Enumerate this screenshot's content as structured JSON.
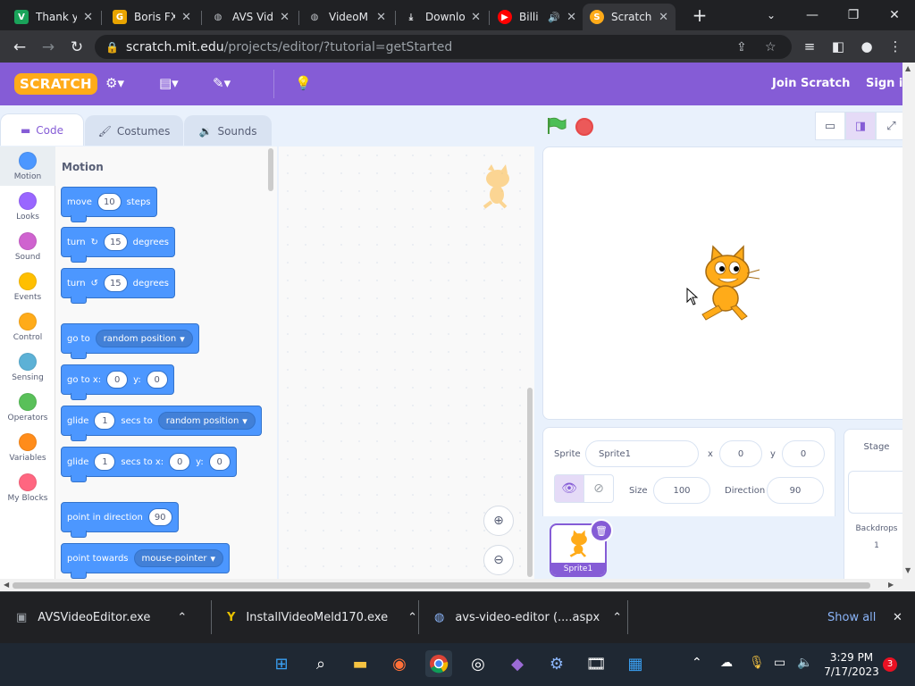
{
  "browser": {
    "tabs": [
      {
        "title": "Thank y",
        "icon": "vimeo-icon",
        "color": "#1aa35a"
      },
      {
        "title": "Boris FX",
        "icon": "g-icon",
        "color": "#e8a400"
      },
      {
        "title": "AVS Vid",
        "icon": "globe-icon",
        "color": "#5f6368"
      },
      {
        "title": "VideoM",
        "icon": "globe-icon",
        "color": "#5f6368"
      },
      {
        "title": "Downlo",
        "icon": "download-icon",
        "color": "#5f6368"
      },
      {
        "title": "Billi",
        "icon": "youtube-icon",
        "color": "#ff0000"
      },
      {
        "title": "Scratch",
        "icon": "scratch-icon",
        "color": "#ffab19"
      }
    ],
    "url_host": "scratch.mit.edu",
    "url_path": "/projects/editor/?tutorial=getStarted"
  },
  "scratch": {
    "menu": {
      "logo": "SCRATCH",
      "join": "Join Scratch",
      "signin": "Sign in"
    },
    "editor_tabs": {
      "code": "Code",
      "costumes": "Costumes",
      "sounds": "Sounds"
    },
    "categories": [
      {
        "label": "Motion",
        "color": "#4c97ff"
      },
      {
        "label": "Looks",
        "color": "#9966ff"
      },
      {
        "label": "Sound",
        "color": "#cf63cf"
      },
      {
        "label": "Events",
        "color": "#ffbf00"
      },
      {
        "label": "Control",
        "color": "#ffab19"
      },
      {
        "label": "Sensing",
        "color": "#5cb1d6"
      },
      {
        "label": "Operators",
        "color": "#59c059"
      },
      {
        "label": "Variables",
        "color": "#ff8c1a"
      },
      {
        "label": "My Blocks",
        "color": "#ff6680"
      }
    ],
    "palette": {
      "title": "Motion",
      "move": {
        "a": "move",
        "n": "10",
        "b": "steps"
      },
      "turn_cw": {
        "a": "turn",
        "n": "15",
        "b": "degrees"
      },
      "turn_ccw": {
        "a": "turn",
        "n": "15",
        "b": "degrees"
      },
      "goto": {
        "a": "go to",
        "d": "random position"
      },
      "goto_xy": {
        "a": "go to x:",
        "x": "0",
        "b": "y:",
        "y": "0"
      },
      "glide": {
        "a": "glide",
        "n": "1",
        "b": "secs to",
        "d": "random position"
      },
      "glide_xy": {
        "a": "glide",
        "n": "1",
        "b": "secs to x:",
        "x": "0",
        "c": "y:",
        "y": "0"
      },
      "point_dir": {
        "a": "point in direction",
        "n": "90"
      },
      "point_towards": {
        "a": "point towards",
        "d": "mouse-pointer"
      }
    },
    "sprite_info": {
      "sprite_label": "Sprite",
      "sprite_name": "Sprite1",
      "x_label": "x",
      "x": "0",
      "y_label": "y",
      "y": "0",
      "size_label": "Size",
      "size": "100",
      "direction_label": "Direction",
      "direction": "90"
    },
    "sprite_list": [
      {
        "name": "Sprite1"
      }
    ],
    "stage_pane": {
      "title": "Stage",
      "backdrops_label": "Backdrops",
      "backdrops_count": "1"
    }
  },
  "downloads": {
    "items": [
      {
        "name": "AVSVideoEditor.exe",
        "icon": "installer-icon"
      },
      {
        "name": "InstallVideoMeld170.exe",
        "icon": "videomeld-icon"
      },
      {
        "name": "avs-video-editor (....aspx",
        "icon": "globe-icon"
      }
    ],
    "show_all": "Show all"
  },
  "taskbar": {
    "time": "3:29 PM",
    "date": "7/17/2023",
    "notifications": "3"
  }
}
